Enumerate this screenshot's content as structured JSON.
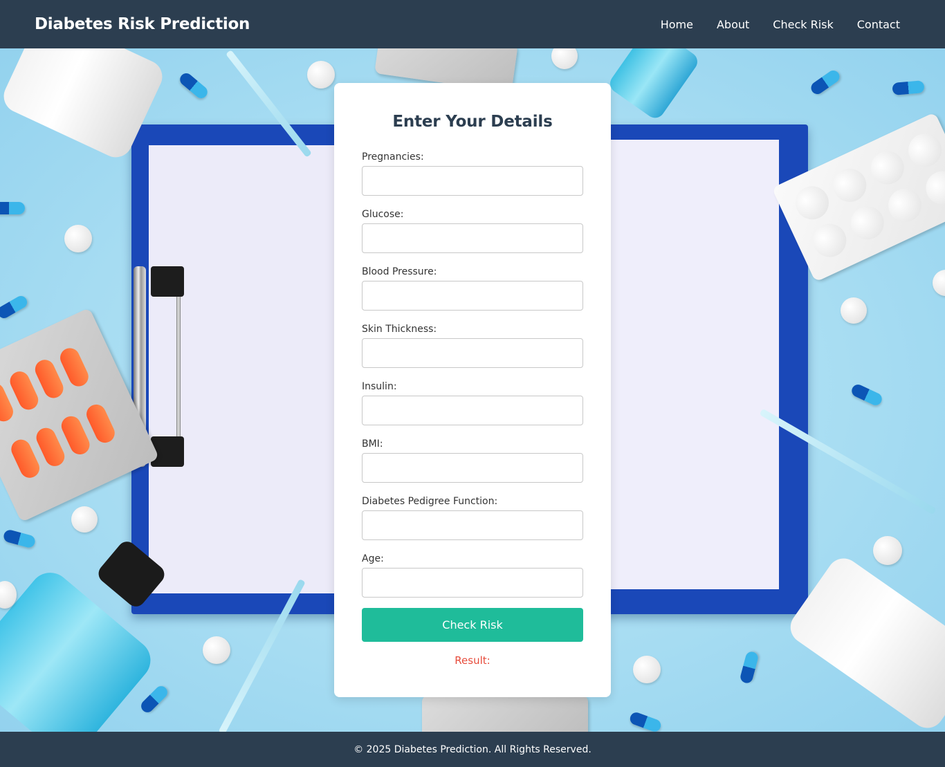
{
  "header": {
    "brand": "Diabetes Risk Prediction",
    "nav": [
      "Home",
      "About",
      "Check Risk",
      "Contact"
    ]
  },
  "form": {
    "title": "Enter Your Details",
    "fields": [
      {
        "label": "Pregnancies:",
        "value": ""
      },
      {
        "label": "Glucose:",
        "value": ""
      },
      {
        "label": "Blood Pressure:",
        "value": ""
      },
      {
        "label": "Skin Thickness:",
        "value": ""
      },
      {
        "label": "Insulin:",
        "value": ""
      },
      {
        "label": "BMI:",
        "value": ""
      },
      {
        "label": "Diabetes Pedigree Function:",
        "value": ""
      },
      {
        "label": "Age:",
        "value": ""
      }
    ],
    "submit_label": "Check Risk",
    "result_label": "Result:"
  },
  "footer": {
    "text": "© 2025 Diabetes Prediction. All Rights Reserved."
  },
  "colors": {
    "header_bg": "#2c3e50",
    "button_bg": "#1fbc9a",
    "result_text": "#e74c3c",
    "title_text": "#2c3e50"
  }
}
